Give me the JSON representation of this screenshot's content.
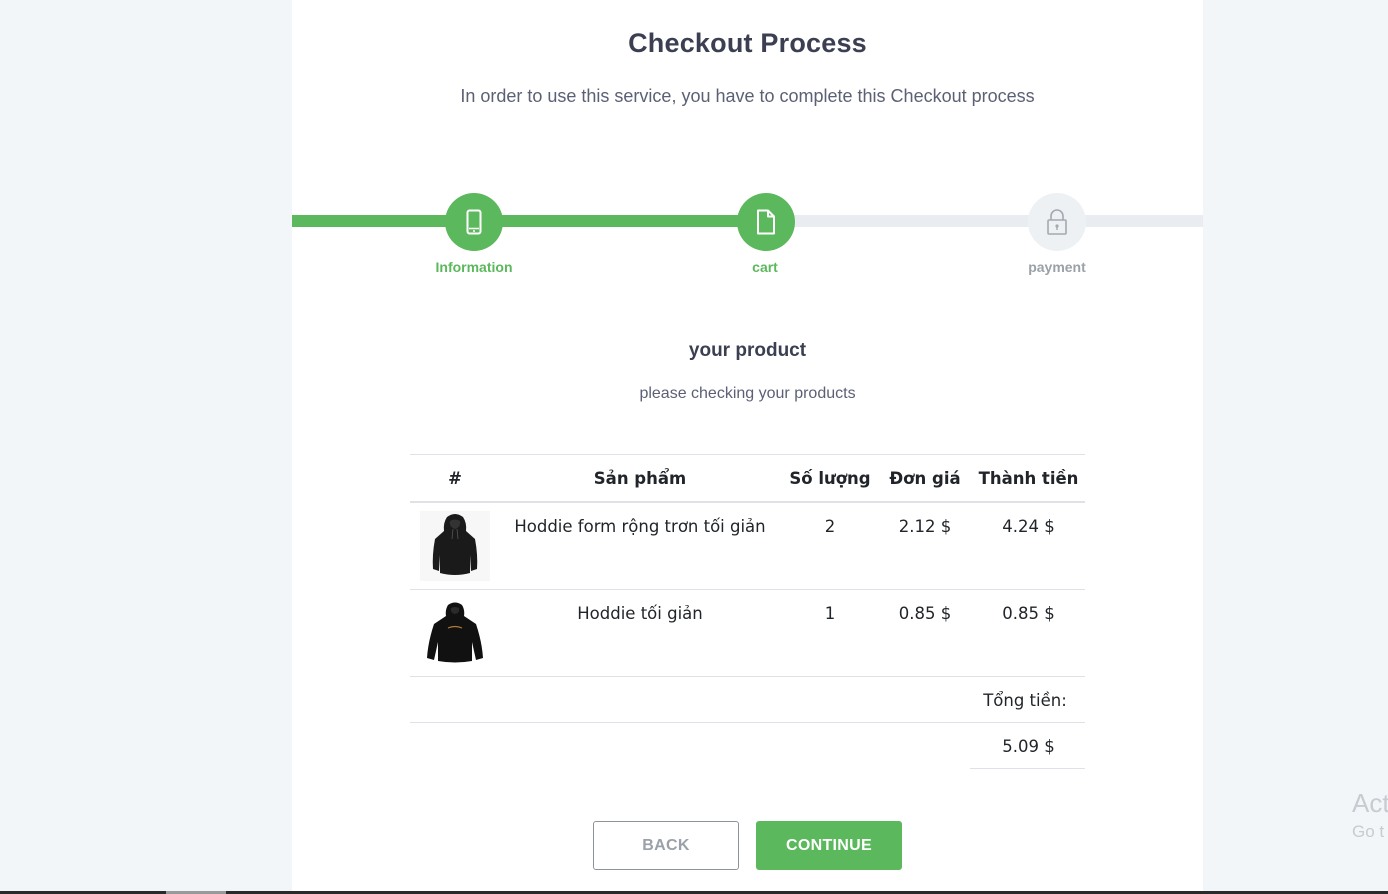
{
  "header": {
    "title": "Checkout Process",
    "subtitle": "In order to use this service, you have to complete this Checkout process"
  },
  "steps": [
    {
      "label": "Information",
      "icon": "phone-icon",
      "state": "active"
    },
    {
      "label": "cart",
      "icon": "file-icon",
      "state": "active"
    },
    {
      "label": "payment",
      "icon": "lock-icon",
      "state": "inactive"
    }
  ],
  "section": {
    "title": "your product",
    "subtitle": "please checking your products"
  },
  "table": {
    "headers": [
      "#",
      "Sản phẩm",
      "Số lượng",
      "Đơn giá",
      "Thành tiền"
    ],
    "rows": [
      {
        "image": "black-hoodie-image",
        "name": "Hoddie form rộng trơn tối giản",
        "qty": "2",
        "price": "2.12 $",
        "total": "4.24 $"
      },
      {
        "image": "black-hoodie-printed-image",
        "name": "Hoddie tối giản",
        "qty": "1",
        "price": "0.85 $",
        "total": "0.85 $"
      }
    ],
    "total_label": "Tổng tiền:",
    "total_value": "5.09 $"
  },
  "buttons": {
    "back": "BACK",
    "continue": "CONTINUE"
  },
  "watermark": {
    "line1": "Act",
    "line2": "Go t"
  },
  "colors": {
    "accent": "#5cb85c",
    "inactive": "#eef1f4",
    "text": "#3b3f51"
  }
}
